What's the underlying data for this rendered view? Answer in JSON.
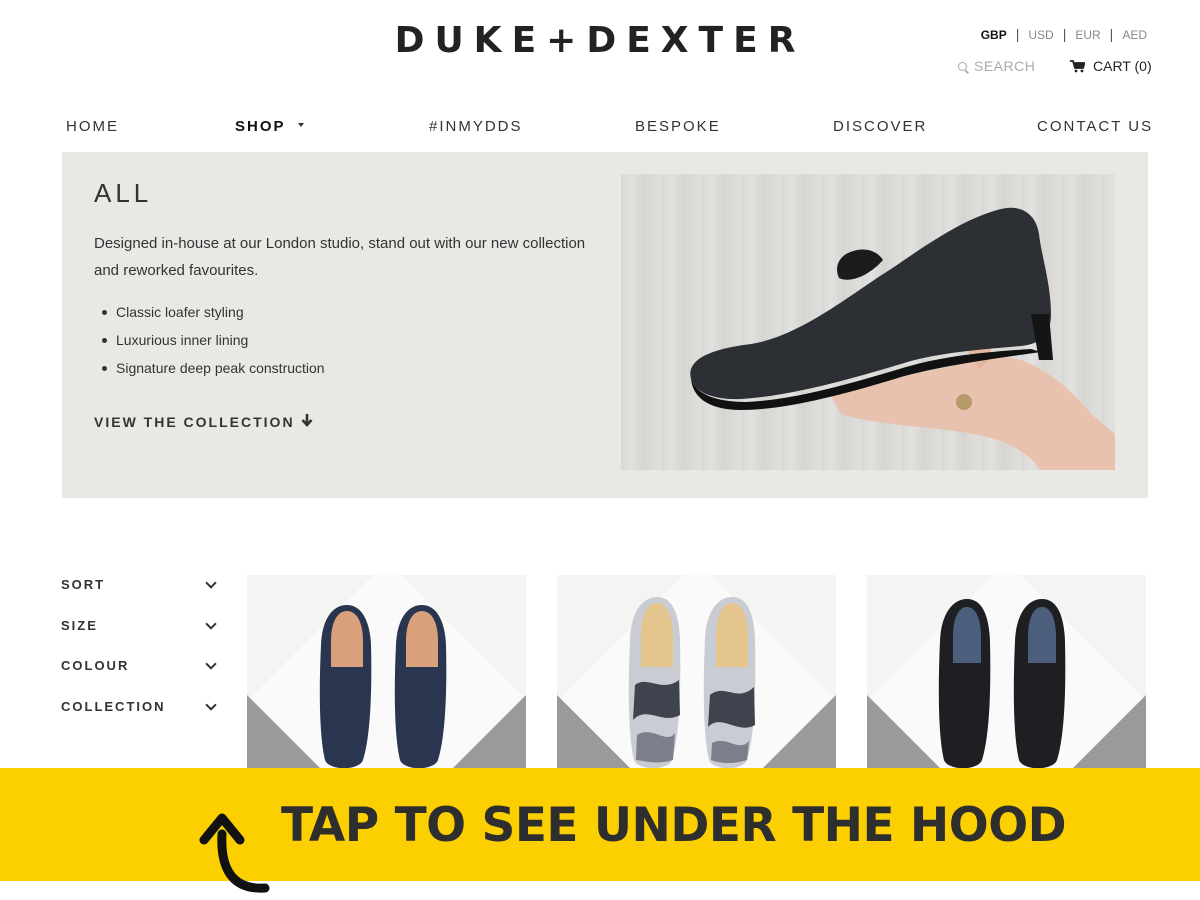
{
  "brand": {
    "logo": "DUKE+DEXTER"
  },
  "currency": {
    "options": [
      "GBP",
      "USD",
      "EUR",
      "AED"
    ],
    "active": "GBP"
  },
  "header": {
    "search_label": "SEARCH",
    "cart_label": "CART (0)"
  },
  "nav": {
    "items": [
      {
        "label": "HOME"
      },
      {
        "label": "SHOP",
        "active": true,
        "dropdown": true
      },
      {
        "label": "#INMYDDS"
      },
      {
        "label": "BESPOKE"
      },
      {
        "label": "DISCOVER"
      },
      {
        "label": "CONTACT US"
      }
    ]
  },
  "hero": {
    "title": "ALL",
    "description": "Designed in-house at our London studio, stand out with our new collection and reworked favourites.",
    "features": [
      "Classic loafer styling",
      "Luxurious inner lining",
      "Signature deep peak construction"
    ],
    "cta": "VIEW THE COLLECTION"
  },
  "filters": {
    "items": [
      "SORT",
      "SIZE",
      "COLOUR",
      "COLLECTION"
    ]
  },
  "products": [
    {
      "image": "navy-suede-loafers"
    },
    {
      "image": "camo-print-loafers"
    },
    {
      "image": "black-mesh-loafers"
    }
  ],
  "banner": {
    "text": "TAP TO SEE UNDER THE HOOD",
    "background": "#fcd000"
  },
  "colors": {
    "accent": "#fcd000",
    "text": "#2b2b2b",
    "hero_bg": "#e9e8e5"
  }
}
